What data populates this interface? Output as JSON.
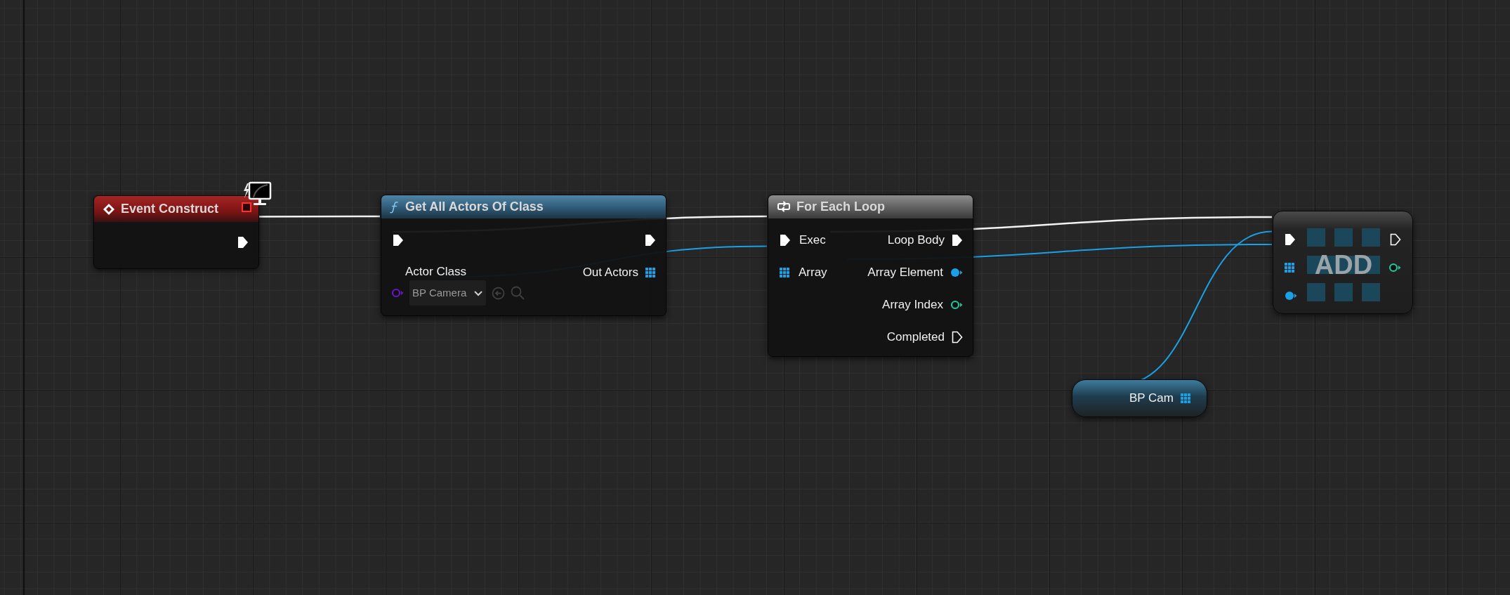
{
  "nodes": [
    {
      "kind": "event",
      "title": "Event Construct",
      "outputs": [
        {
          "kind": "exec",
          "connected": true
        }
      ]
    },
    {
      "kind": "function",
      "title": "Get All Actors Of Class",
      "inputs": [
        {
          "kind": "exec",
          "connected": true
        },
        {
          "kind": "class",
          "connected": false,
          "label": "Actor Class",
          "value": "BP Camera"
        }
      ],
      "outputs": [
        {
          "kind": "exec",
          "connected": true
        },
        {
          "kind": "array",
          "connected": true,
          "label": "Out Actors"
        }
      ]
    },
    {
      "kind": "macro",
      "title": "For Each Loop",
      "inputs": [
        {
          "kind": "exec",
          "connected": true,
          "label": "Exec"
        },
        {
          "kind": "array",
          "connected": true,
          "label": "Array"
        }
      ],
      "outputs": [
        {
          "kind": "exec",
          "connected": true,
          "label": "Loop Body"
        },
        {
          "kind": "object",
          "connected": true,
          "label": "Array Element"
        },
        {
          "kind": "int",
          "connected": false,
          "label": "Array Index"
        },
        {
          "kind": "exec",
          "connected": false,
          "label": "Completed"
        }
      ]
    },
    {
      "kind": "compact",
      "title": "ADD",
      "inputs": [
        {
          "kind": "exec",
          "connected": true
        },
        {
          "kind": "array",
          "connected": true
        },
        {
          "kind": "object",
          "connected": true
        }
      ],
      "outputs": [
        {
          "kind": "exec",
          "connected": false
        },
        {
          "kind": "int",
          "connected": false
        }
      ]
    },
    {
      "kind": "variable",
      "title": "BP Cam",
      "outputs": [
        {
          "kind": "array",
          "connected": true
        }
      ]
    }
  ]
}
